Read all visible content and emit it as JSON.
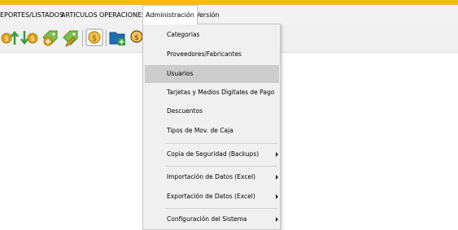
{
  "menubar": {
    "items": [
      {
        "label": "EPORTES/LISTADOS"
      },
      {
        "label": "ARTICULOS"
      },
      {
        "label": "OPERACIONES"
      },
      {
        "label": "Administración"
      },
      {
        "label": "Versión"
      }
    ]
  },
  "toolbar": {
    "buttons": [
      {
        "icon": "dollar-up-arrow-icon"
      },
      {
        "icon": "dollar-down-arrow-icon"
      },
      {
        "icon": "tag-add-icon"
      },
      {
        "icon": "tag-edit-icon"
      },
      {
        "icon": "coin-icon"
      },
      {
        "icon": "folder-add-icon"
      },
      {
        "icon": "coin-person-icon"
      }
    ]
  },
  "admin_menu": {
    "items": [
      {
        "label": "Categorias",
        "submenu": false
      },
      {
        "label": "Proveedores/Fabricantes",
        "submenu": false
      },
      {
        "label": "Usuarios",
        "submenu": false,
        "highlighted": true
      },
      {
        "label": "Tarjetas y Medios Digitales de Pago",
        "submenu": false
      },
      {
        "label": "Descuentos",
        "submenu": false
      },
      {
        "label": "Tipos de Mov. de Caja",
        "submenu": false
      },
      {
        "label": "Copia de Seguridad (Backups)",
        "submenu": true
      },
      {
        "label": "Importación de Datos (Excel)",
        "submenu": true
      },
      {
        "label": "Exportación de Datos (Excel)",
        "submenu": true
      },
      {
        "label": "Configuración del Sistema",
        "submenu": true
      }
    ]
  },
  "colors": {
    "accent_bar": "#fdb913",
    "menu_highlight": "#cccccc",
    "icon_green": "#2e9e3a",
    "icon_gold": "#e0a11b",
    "icon_blue": "#1f6fb5"
  }
}
